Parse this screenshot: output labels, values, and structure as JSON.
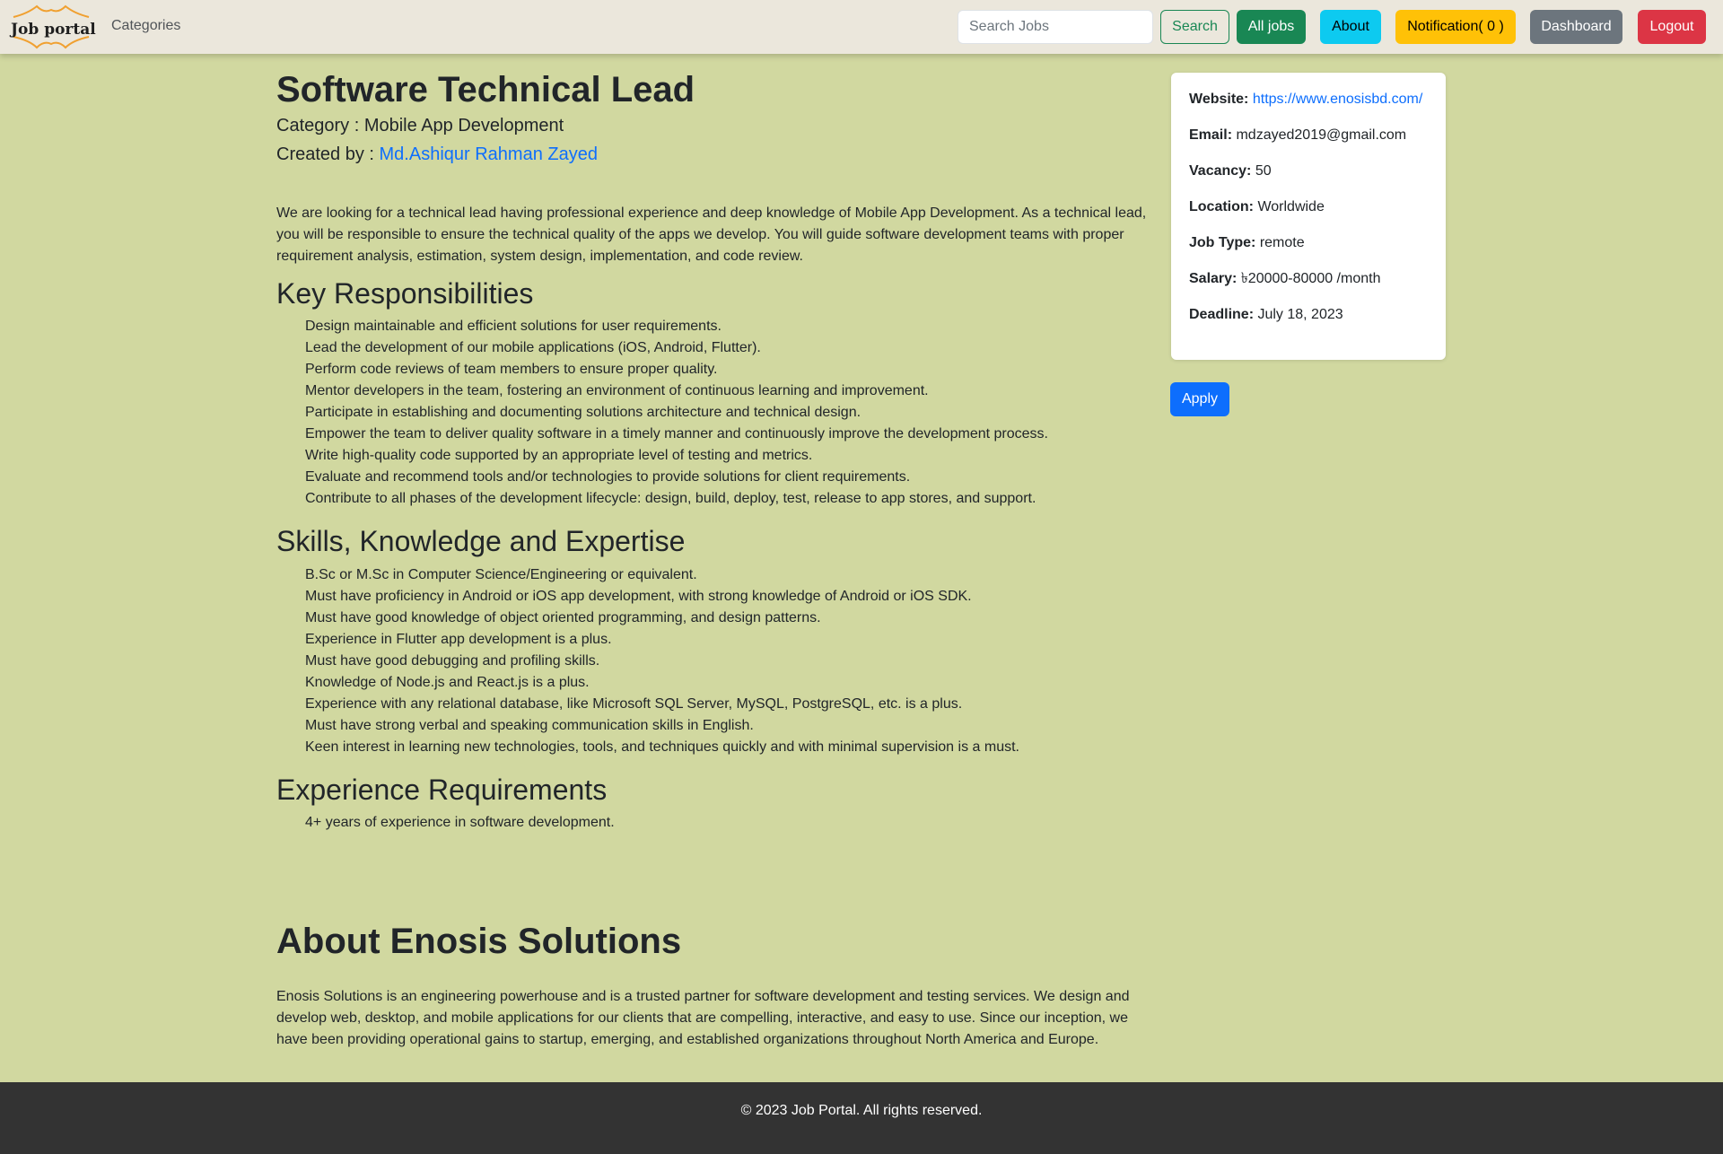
{
  "navbar": {
    "brand": "Job portal",
    "categories_link": "Categories",
    "search_placeholder": "Search Jobs",
    "search_button": "Search",
    "all_jobs_button": "All jobs",
    "about_button": "About",
    "notification_button": "Notification( 0 )",
    "dashboard_button": "Dashboard",
    "logout_button": "Logout"
  },
  "job": {
    "title": "Software Technical Lead",
    "category_label": "Category : ",
    "category": "Mobile App Development",
    "created_by_label": "Created by : ",
    "creator": "Md.Ashiqur Rahman Zayed",
    "description": "We are looking for a technical lead having professional experience and deep knowledge of Mobile App Development. As a technical lead, you will be responsible to ensure the technical quality of the apps we develop. You will guide software development teams with proper requirement analysis, estimation, system design, implementation, and code review.",
    "responsibilities_heading": "Key Responsibilities",
    "responsibilities": [
      "Design maintainable and efficient solutions for user requirements.",
      "Lead the development of our mobile applications (iOS, Android, Flutter).",
      "Perform code reviews of team members to ensure proper quality.",
      "Mentor developers in the team, fostering an environment of continuous learning and improvement.",
      "Participate in establishing and documenting solutions architecture and technical design.",
      "Empower the team to deliver quality software in a timely manner and continuously improve the development process.",
      "Write high-quality code supported by an appropriate level of testing and metrics.",
      "Evaluate and recommend tools and/or technologies to provide solutions for client requirements.",
      "Contribute to all phases of the development lifecycle: design, build, deploy, test, release to app stores, and support."
    ],
    "skills_heading": "Skills, Knowledge and Expertise",
    "skills": [
      "B.Sc or M.Sc in Computer Science/Engineering or equivalent.",
      "Must have proficiency in Android or iOS app development, with strong knowledge of Android or iOS SDK.",
      "Must have good knowledge of object oriented programming, and design patterns.",
      "Experience in Flutter app development is a plus.",
      "Must have good debugging and profiling skills.",
      "Knowledge of Node.js and React.js is a plus.",
      "Experience with any relational database, like Microsoft SQL Server, MySQL, PostgreSQL, etc. is a plus.",
      "Must have strong verbal and speaking communication skills in English.",
      "Keen interest in learning new technologies, tools, and techniques quickly and with minimal supervision is a must."
    ],
    "experience_heading": "Experience Requirements",
    "experience": [
      "4+ years of experience in software development."
    ]
  },
  "sidebar": {
    "website_label": "Website:",
    "website": "https://www.enosisbd.com/",
    "email_label": "Email:",
    "email": "mdzayed2019@gmail.com",
    "vacancy_label": "Vacancy:",
    "vacancy": "50",
    "location_label": "Location:",
    "location": "Worldwide",
    "job_type_label": "Job Type:",
    "job_type": "remote",
    "salary_label": "Salary:",
    "salary": "৳20000-80000 /month",
    "deadline_label": "Deadline:",
    "deadline": "July 18, 2023",
    "apply_button": "Apply"
  },
  "company": {
    "heading": "About Enosis Solutions",
    "description": "Enosis Solutions is an engineering powerhouse and is a trusted partner for software development and testing services. We design and develop web, desktop, and mobile applications for our clients that are compelling, interactive, and easy to use. Since our inception, we have been providing operational gains to startup, emerging, and established organizations throughout North America and Europe."
  },
  "footer": {
    "text": "© 2023 Job Portal. All rights reserved."
  },
  "colors": {
    "page_background": "#d1d8a0",
    "navbar_background": "#ebe7dc",
    "footer_background": "#333333",
    "link": "#0d6efd",
    "logo_accent": "#f0a030"
  }
}
